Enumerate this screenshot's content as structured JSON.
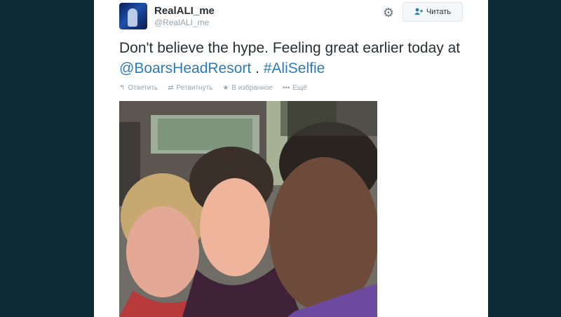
{
  "user": {
    "display_name": "RealALI_me",
    "handle": "@RealALI_me"
  },
  "follow_button": {
    "label": "Читать",
    "icon": "add-user-icon"
  },
  "tweet": {
    "text_part1": "Don't believe the hype. Feeling great earlier today at ",
    "mention": "@BoarsHeadResort",
    "text_part2": " . ",
    "hashtag": "#AliSelfie"
  },
  "actions": [
    {
      "label": "Ответить",
      "icon": "reply-icon"
    },
    {
      "label": "Ретвитнуть",
      "icon": "retweet-icon"
    },
    {
      "label": "В избранное",
      "icon": "star-icon"
    },
    {
      "label": "Ещё",
      "icon": "more-icon"
    }
  ],
  "colors": {
    "page_background": "#0e2a35",
    "card": "#ffffff",
    "link": "#2b7bb9",
    "muted": "#99a3ab"
  }
}
